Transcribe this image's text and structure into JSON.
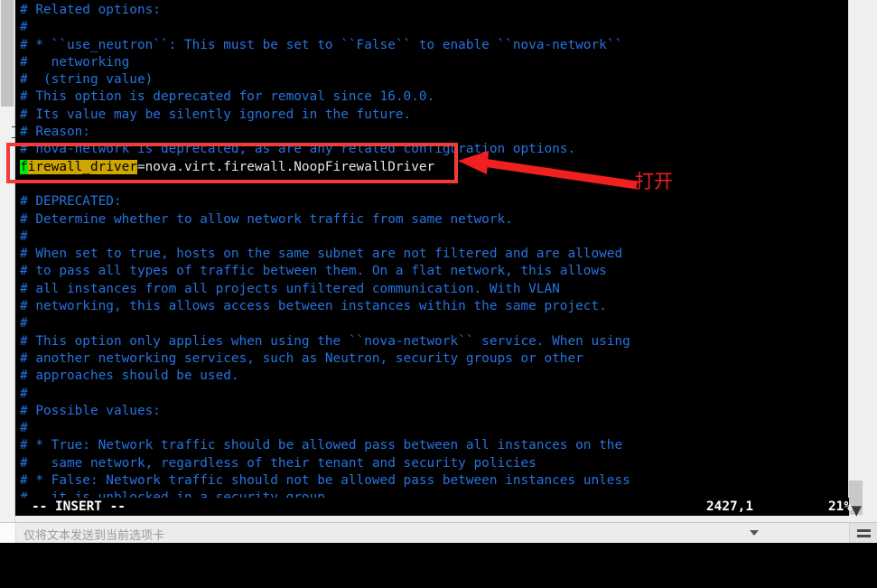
{
  "editor": {
    "filetype_note": "vim",
    "lines": [
      {
        "text": "# Related options:",
        "kind": "comment"
      },
      {
        "text": "#",
        "kind": "comment"
      },
      {
        "text": "# * ``use_neutron``: This must be set to ``False`` to enable ``nova-network``",
        "kind": "comment"
      },
      {
        "text": "#   networking",
        "kind": "comment"
      },
      {
        "text": "#  (string value)",
        "kind": "comment"
      },
      {
        "text": "# This option is deprecated for removal since 16.0.0.",
        "kind": "comment"
      },
      {
        "text": "# Its value may be silently ignored in the future.",
        "kind": "comment"
      },
      {
        "text": "# Reason:",
        "kind": "comment"
      },
      {
        "text": "# nova-network is deprecated, as are any related configuration options.",
        "kind": "comment"
      },
      {
        "text": "firewall_driver=nova.virt.firewall.NoopFirewallDriver",
        "kind": "config"
      },
      {
        "text": "",
        "kind": "blank"
      },
      {
        "text": "# DEPRECATED:",
        "kind": "comment"
      },
      {
        "text": "# Determine whether to allow network traffic from same network.",
        "kind": "comment"
      },
      {
        "text": "#",
        "kind": "comment"
      },
      {
        "text": "# When set to true, hosts on the same subnet are not filtered and are allowed",
        "kind": "comment"
      },
      {
        "text": "# to pass all types of traffic between them. On a flat network, this allows",
        "kind": "comment"
      },
      {
        "text": "# all instances from all projects unfiltered communication. With VLAN",
        "kind": "comment"
      },
      {
        "text": "# networking, this allows access between instances within the same project.",
        "kind": "comment"
      },
      {
        "text": "#",
        "kind": "comment"
      },
      {
        "text": "# This option only applies when using the ``nova-network`` service. When using",
        "kind": "comment"
      },
      {
        "text": "# another networking services, such as Neutron, security groups or other",
        "kind": "comment"
      },
      {
        "text": "# approaches should be used.",
        "kind": "comment"
      },
      {
        "text": "#",
        "kind": "comment"
      },
      {
        "text": "# Possible values:",
        "kind": "comment"
      },
      {
        "text": "#",
        "kind": "comment"
      },
      {
        "text": "# * True: Network traffic should be allowed pass between all instances on the",
        "kind": "comment"
      },
      {
        "text": "#   same network, regardless of their tenant and security policies",
        "kind": "comment"
      },
      {
        "text": "# * False: Network traffic should not be allowed pass between instances unless",
        "kind": "comment"
      },
      {
        "text": "#   it is unblocked in a security group",
        "kind": "comment"
      }
    ],
    "config_line": {
      "cursor_char": "f",
      "highlighted_key": "irewall_driver",
      "rest": "=nova.virt.firewall.NoopFirewallDriver"
    }
  },
  "status": {
    "mode": "-- INSERT --",
    "position": "2427,1",
    "percent": "21%"
  },
  "annotation": {
    "label": "打开",
    "box_color": "#f33b3b",
    "arrow_color": "#f02020"
  },
  "bottom": {
    "hint": "仅将文本发送到当前选项卡"
  },
  "colors": {
    "comment": "#2673df",
    "cursor": "#00ee00",
    "search_highlight": "#cfa500",
    "background": "#000000",
    "status_text": "#ffffff"
  }
}
